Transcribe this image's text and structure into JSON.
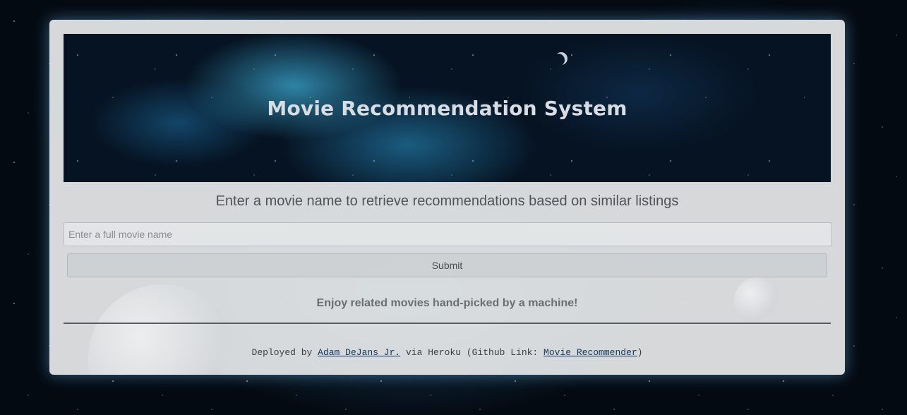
{
  "hero": {
    "title": "Movie Recommendation System"
  },
  "main": {
    "subtitle": "Enter a movie name to retrieve recommendations based on similar listings",
    "search": {
      "placeholder": "Enter a full movie name",
      "value": ""
    },
    "submit_label": "Submit",
    "tagline": "Enjoy related movies hand-picked by a machine!"
  },
  "footer": {
    "prefix": "Deployed by",
    "author_link": "Adam DeJans Jr.",
    "middle": "via Heroku (Github Link:",
    "repo_link": "Movie Recommender",
    "suffix": ")"
  },
  "colors": {
    "panel_bg": "#e6e8ea",
    "link": "#12345c",
    "glow": "#78c8ff"
  }
}
